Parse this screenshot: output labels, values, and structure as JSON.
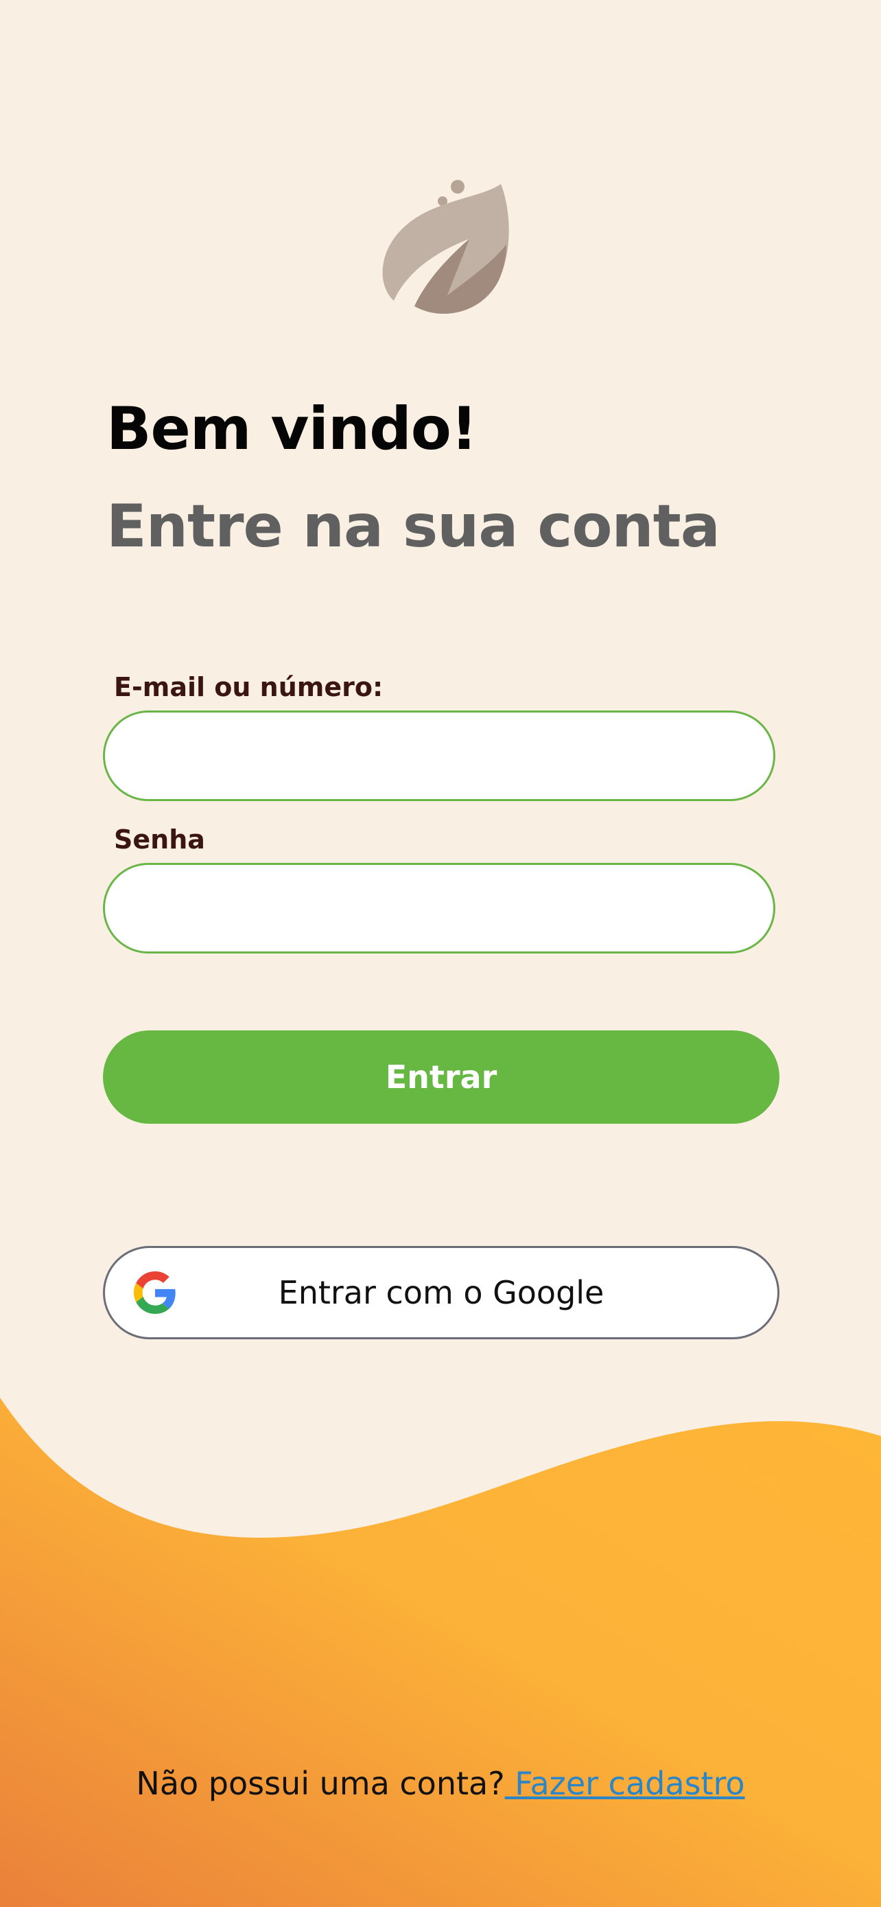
{
  "logo": {
    "icon": "leaf-logo-icon"
  },
  "header": {
    "title": "Bem vindo!",
    "subtitle": "Entre na sua conta"
  },
  "form": {
    "email_label": "E-mail ou número:",
    "email_value": "",
    "password_label": "Senha",
    "password_value": "",
    "submit_label": "Entrar"
  },
  "google": {
    "label": "Entrar com o Google",
    "icon": "google-icon"
  },
  "footer": {
    "prompt": "Não possui uma conta?",
    "link": " Fazer cadastro"
  },
  "colors": {
    "background": "#f9f0e3",
    "accent_green": "#67b843",
    "wave_light": "#feb637",
    "wave_dark": "#ea813a",
    "link": "#2a86c8",
    "label": "#3b1512"
  }
}
